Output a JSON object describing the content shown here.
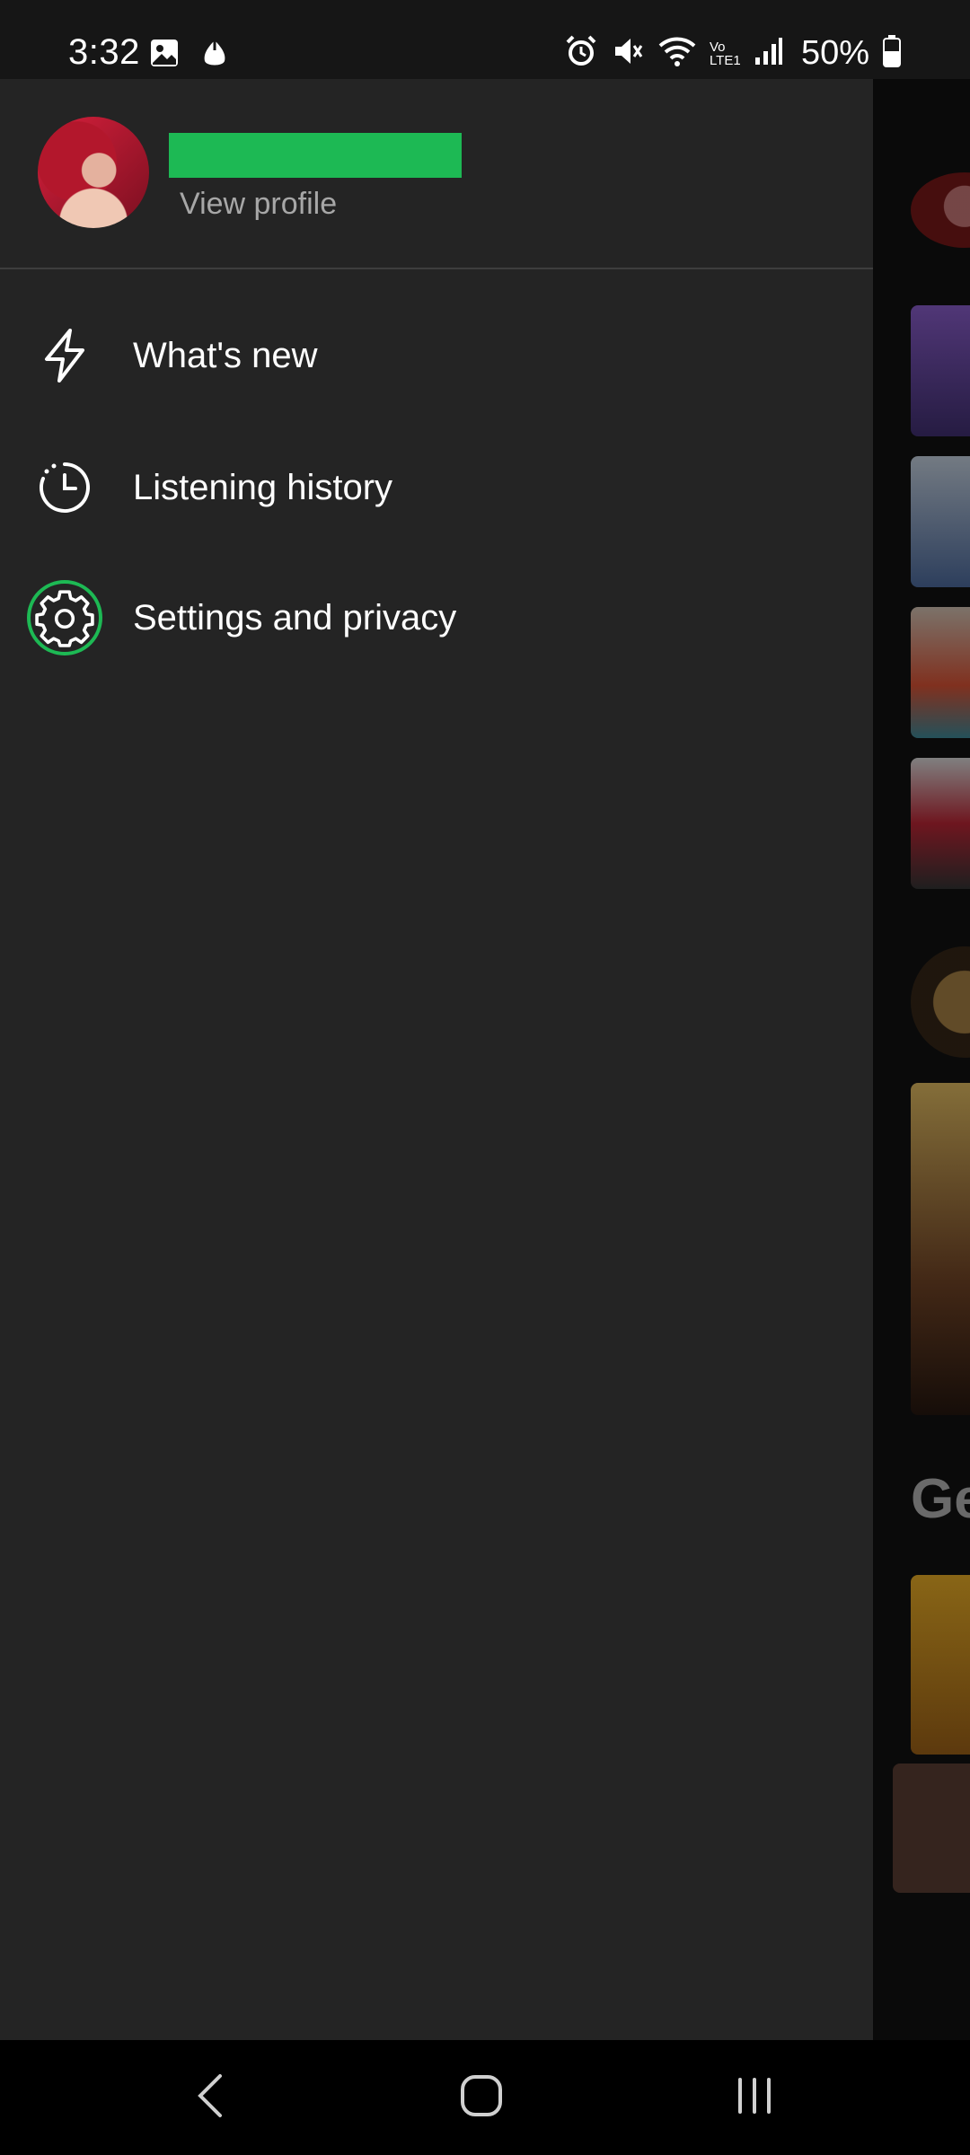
{
  "status_bar": {
    "time": "3:32",
    "battery_percent": "50%",
    "network_label": "Vo LTE1",
    "icons": [
      "gallery-icon",
      "animal-crossing-icon",
      "alarm-icon",
      "mute-icon",
      "wifi-icon",
      "signal-icon",
      "battery-icon"
    ]
  },
  "profile": {
    "username_redacted": true,
    "view_profile_label": "View profile"
  },
  "menu": {
    "items": [
      {
        "id": "whats-new",
        "label": "What's new",
        "icon": "lightning-icon"
      },
      {
        "id": "listening-history",
        "label": "Listening history",
        "icon": "history-clock-icon"
      },
      {
        "id": "settings",
        "label": "Settings and privacy",
        "icon": "gear-icon",
        "focused": true
      }
    ]
  },
  "background_app": {
    "partial_heading": "Ge"
  },
  "colors": {
    "accent": "#1db954",
    "drawer_bg": "#242424",
    "text_secondary": "#a7a7a7"
  },
  "nav_bar": {
    "icons": [
      "back-icon",
      "home-icon",
      "recents-icon"
    ]
  }
}
